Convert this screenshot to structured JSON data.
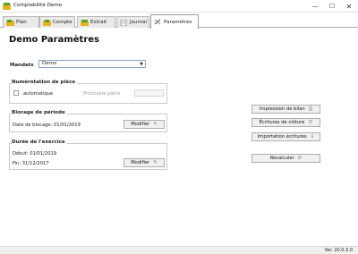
{
  "window": {
    "title": "Comptabilité Demo",
    "min": "—",
    "max": "☐",
    "close": "✕"
  },
  "tabs": [
    {
      "label": "Plan"
    },
    {
      "label": "Compte"
    },
    {
      "label": "Extrait"
    },
    {
      "label": "Journal"
    },
    {
      "label": "Paramètres"
    }
  ],
  "page": {
    "title": "Demo Paramètres"
  },
  "mandats": {
    "label": "Mandats",
    "value": "Demo"
  },
  "numerotation": {
    "title": "Numérotation de pièce",
    "checkbox_label": "automatique",
    "prochaine_label": "Prochaine pièce",
    "prochaine_value": ""
  },
  "blocage": {
    "title": "Blocage de période",
    "date_text": "Date de blocage: 01/01/2019",
    "button": "Modifier"
  },
  "exercice": {
    "title": "Durée de l'exercice",
    "debut": "Début: 01/01/2019",
    "fin": "Fin: 31/12/2017",
    "button": "Modifier"
  },
  "actions": {
    "impression": "Impression de bilan",
    "ecritures_cloture": "Écritures de clôture",
    "importation": "Importation écritures",
    "recalculer": "Recalculer"
  },
  "status": {
    "version": "Ver. 20.0.3.0"
  },
  "colors": {
    "accent": "#8aa6c7",
    "icon_green": "#5aa02c",
    "icon_yellow": "#e6b422"
  }
}
